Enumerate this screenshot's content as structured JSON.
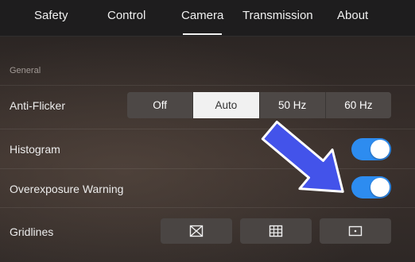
{
  "tabs": [
    {
      "label": "Safety",
      "active": false
    },
    {
      "label": "Control",
      "active": false
    },
    {
      "label": "Camera",
      "active": true
    },
    {
      "label": "Transmission",
      "active": false
    },
    {
      "label": "About",
      "active": false
    }
  ],
  "section": {
    "label": "General"
  },
  "anti_flicker": {
    "label": "Anti-Flicker",
    "options": [
      "Off",
      "Auto",
      "50 Hz",
      "60 Hz"
    ],
    "selected": "Auto"
  },
  "histogram": {
    "label": "Histogram",
    "enabled": true
  },
  "overexposure": {
    "label": "Overexposure Warning",
    "enabled": true
  },
  "gridlines": {
    "label": "Gridlines",
    "options": [
      {
        "icon": "diagonal-grid-icon"
      },
      {
        "icon": "nine-grid-icon"
      },
      {
        "icon": "center-point-icon"
      }
    ]
  },
  "colors": {
    "toggle_on": "#2d8cf0",
    "arrow": "#4353ea",
    "tab_bar": "#1e1d1e"
  }
}
